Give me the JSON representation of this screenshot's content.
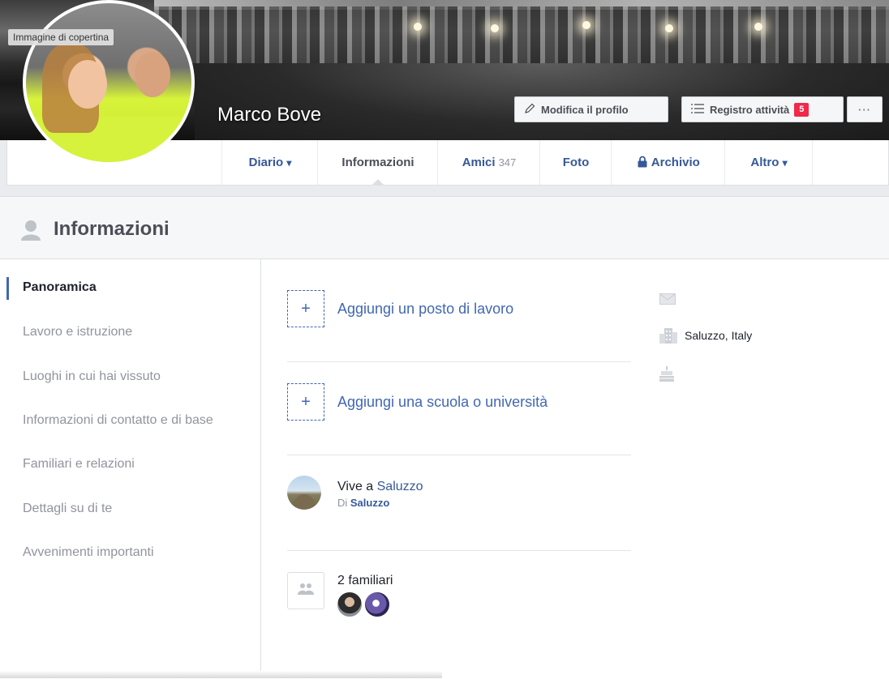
{
  "cover": {
    "label": "Immagine di copertina"
  },
  "profile": {
    "name": "Marco Bove"
  },
  "actions": {
    "edit_label": "Modifica il profilo",
    "activity_label": "Registro attività",
    "activity_badge": "5",
    "more_label": "···"
  },
  "nav": {
    "tabs": [
      {
        "label": "Diario",
        "arrow": "▾"
      },
      {
        "label": "Informazioni"
      },
      {
        "label": "Amici",
        "count": "347"
      },
      {
        "label": "Foto"
      },
      {
        "label": "Archivio"
      },
      {
        "label": "Altro",
        "arrow": "▾"
      }
    ]
  },
  "section": {
    "title": "Informazioni"
  },
  "sidebar": {
    "items": [
      {
        "label": "Panoramica",
        "active": true
      },
      {
        "label": "Lavoro e istruzione"
      },
      {
        "label": "Luoghi in cui hai vissuto"
      },
      {
        "label": "Informazioni di contatto e di base"
      },
      {
        "label": "Familiari e relazioni"
      },
      {
        "label": "Dettagli su di te"
      },
      {
        "label": "Avvenimenti importanti"
      }
    ]
  },
  "overview": {
    "add_plus": "+",
    "add_work": "Aggiungi un posto di lavoro",
    "add_school": "Aggiungi una scuola o università",
    "lives_prefix": "Vive a ",
    "lives_city": "Saluzzo",
    "from_prefix": "Di ",
    "from_city": "Saluzzo",
    "family_count": "2 familiari"
  },
  "right_column": {
    "location": "Saluzzo, Italy",
    "icons": [
      "envelope-icon",
      "building-icon",
      "cake-icon"
    ]
  },
  "colors": {
    "link_blue": "#365899",
    "accent_blue": "#4267b2",
    "badge_red": "#f02849"
  }
}
